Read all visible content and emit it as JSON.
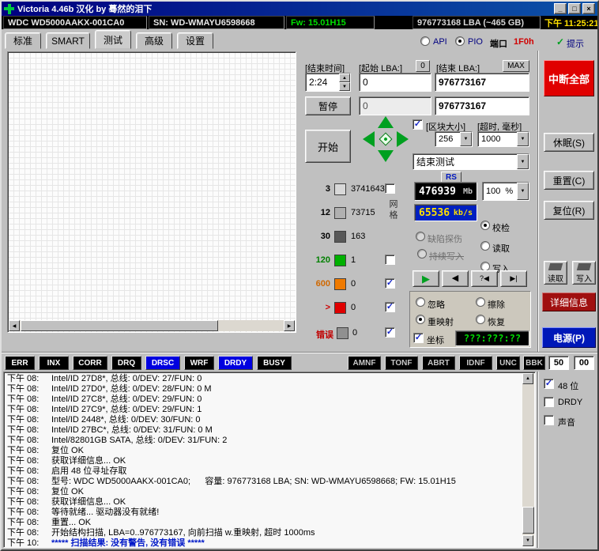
{
  "titlebar": {
    "title": "Victoria 4.46b 汉化 by 蓦然的泪下"
  },
  "icons": {
    "minimize": "_",
    "maximize": "□",
    "close": "×",
    "dropdown": "▼",
    "spin_up": "▲",
    "spin_down": "▼",
    "check": "✓",
    "scroll_left": "◀",
    "scroll_right": "▶",
    "scroll_up": "▲",
    "scroll_down": "▼",
    "play": "▶",
    "step_back": "◀",
    "seek": "?◀",
    "step_end": "▶|"
  },
  "infobar": {
    "model": "WDC WD5000AAKX-001CA0",
    "serial": "SN: WD-WMAYU6598668",
    "firmware": "Fw: 15.01H15",
    "capacity": "976773168 LBA (~465 GB)",
    "clock": "下午 11:25:21"
  },
  "tabbar": {
    "tabs": [
      {
        "label": "标准",
        "active": false
      },
      {
        "label": "SMART",
        "active": false
      },
      {
        "label": "测试",
        "active": true
      },
      {
        "label": "高级",
        "active": false
      },
      {
        "label": "设置",
        "active": false
      }
    ],
    "api_label": "API",
    "pio_label": "PIO",
    "pio_selected": true,
    "port_label": "端口",
    "port_value": "1F0h",
    "hint_label": "提示",
    "hint_checked": true
  },
  "test": {
    "end_time_label": "[结束时间]",
    "start_lba_label": "[起始 LBA:]",
    "zero_button": "0",
    "end_lba_label": "[结束 LBA:]",
    "max_button": "MAX",
    "timer_value": "2:24",
    "start_lba_value": "0",
    "end_lba_value": "976773167",
    "pause_button": "暂停",
    "current_lba_value": "0",
    "end_lba_value_2": "976773167",
    "block_size_checked": true,
    "block_size_label": "[区块大小]",
    "timeout_label": "[超时, 毫秒]",
    "block_size_value": "256",
    "timeout_value": "1000",
    "start_button": "开始",
    "end_action_value": "结束测试",
    "rs_button": "RS",
    "grid_label": "网格",
    "blocks": [
      {
        "threshold": "3",
        "count": "3741643",
        "color": "#d8d8d8",
        "tcolor": "#000000"
      },
      {
        "threshold": "12",
        "count": "73715",
        "color": "#b0b0b0",
        "tcolor": "#000000"
      },
      {
        "threshold": "30",
        "count": "163",
        "color": "#585858",
        "tcolor": "#000000"
      },
      {
        "threshold": "120",
        "count": "1",
        "color": "#00b000",
        "tcolor": "#008000"
      },
      {
        "threshold": "600",
        "count": "0",
        "color": "#ef7a00",
        "tcolor": "#d06800"
      },
      {
        "threshold": ">",
        "count": "0",
        "color": "#e00000",
        "tcolor": "#cc0000"
      }
    ],
    "block_checks": [
      false,
      false,
      true,
      true
    ],
    "error_label": "错误",
    "error_count": "0",
    "error_checked": true,
    "mb_value": "476939",
    "mb_unit": "Mb",
    "percent_value": "100",
    "percent_unit": "%",
    "speed_value": "65536",
    "speed_unit": "kb/s",
    "mode_verify": "校检",
    "mode_defect": "缺陷探伤",
    "mode_read": "读取",
    "mode_loop_write": "持续写入",
    "mode_write": "写入",
    "mode_selected": "校检",
    "act_ignore": "忽略",
    "act_erase": "擦除",
    "act_remap": "重映射",
    "act_restore": "恢复",
    "act_selected": "重映射",
    "coord_label": "坐标",
    "coord_checked": true,
    "coord_value": "???:???:??"
  },
  "statusbar": {
    "flags": [
      {
        "label": "ERR",
        "active": false
      },
      {
        "label": "INX",
        "active": false
      },
      {
        "label": "CORR",
        "active": false
      },
      {
        "label": "DRQ",
        "active": false
      },
      {
        "label": "DRSC",
        "active": true
      },
      {
        "label": "WRF",
        "active": false
      },
      {
        "label": "DRDY",
        "active": true
      },
      {
        "label": "BUSY",
        "active": false
      }
    ],
    "errors": [
      {
        "label": "AMNF"
      },
      {
        "label": "TONF"
      },
      {
        "label": "ABRT"
      },
      {
        "label": "IDNF"
      },
      {
        "label": "UNC"
      },
      {
        "label": "BBK"
      }
    ],
    "reg_status": "50",
    "reg_error": "00"
  },
  "sidebar": {
    "break_all_button": "中断全部",
    "sleep_button": "休眠(S)",
    "recall_button": "重置(C)",
    "reset_button": "复位(R)",
    "read_mini_button": "读取",
    "write_mini_button": "写入",
    "passport_button": "详细信息",
    "power_button": "电源(P)",
    "checks": [
      {
        "label": "48 位",
        "checked": true
      },
      {
        "label": "DRDY",
        "checked": false
      },
      {
        "label": "声音",
        "checked": false
      }
    ]
  },
  "log": {
    "lines": [
      {
        "time": "下午 08:",
        "text": "Intel/ID 27D8*, 总线: 0/DEV: 27/FUN: 0"
      },
      {
        "time": "下午 08:",
        "text": "Intel/ID 27D0*, 总线: 0/DEV: 28/FUN: 0 M"
      },
      {
        "time": "下午 08:",
        "text": "Intel/ID 27C8*, 总线: 0/DEV: 29/FUN: 0"
      },
      {
        "time": "下午 08:",
        "text": "Intel/ID 27C9*, 总线: 0/DEV: 29/FUN: 1"
      },
      {
        "time": "下午 08:",
        "text": "Intel/ID 2448*, 总线: 0/DEV: 30/FUN: 0"
      },
      {
        "time": "下午 08:",
        "text": "Intel/ID 27BC*, 总线: 0/DEV: 31/FUN: 0 M"
      },
      {
        "time": "下午 08:",
        "text": "Intel/82801GB SATA, 总线: 0/DEV: 31/FUN: 2"
      },
      {
        "time": "下午 08:",
        "text": "复位 OK"
      },
      {
        "time": "下午 08:",
        "text": "获取详细信息... OK"
      },
      {
        "time": "下午 08:",
        "text": "启用 48 位寻址存取"
      },
      {
        "time": "下午 08:",
        "text": "型号: WDC WD5000AAKX-001CA0;      容量: 976773168 LBA; SN: WD-WMAYU6598668; FW: 15.01H15"
      },
      {
        "time": "下午 08:",
        "text": "复位 OK"
      },
      {
        "time": "下午 08:",
        "text": "获取详细信息... OK"
      },
      {
        "time": "下午 08:",
        "text": "等待就绪... 驱动器没有就绪!"
      },
      {
        "time": "下午 08:",
        "text": "重置... OK"
      },
      {
        "time": "下午 08:",
        "text": "开始结构扫描, LBA=0..976773167, 向前扫描 w.重映射, 超时 1000ms"
      },
      {
        "time": "下午 10:",
        "text": "***** 扫描结果: 没有警告, 没有错误 *****"
      }
    ]
  }
}
